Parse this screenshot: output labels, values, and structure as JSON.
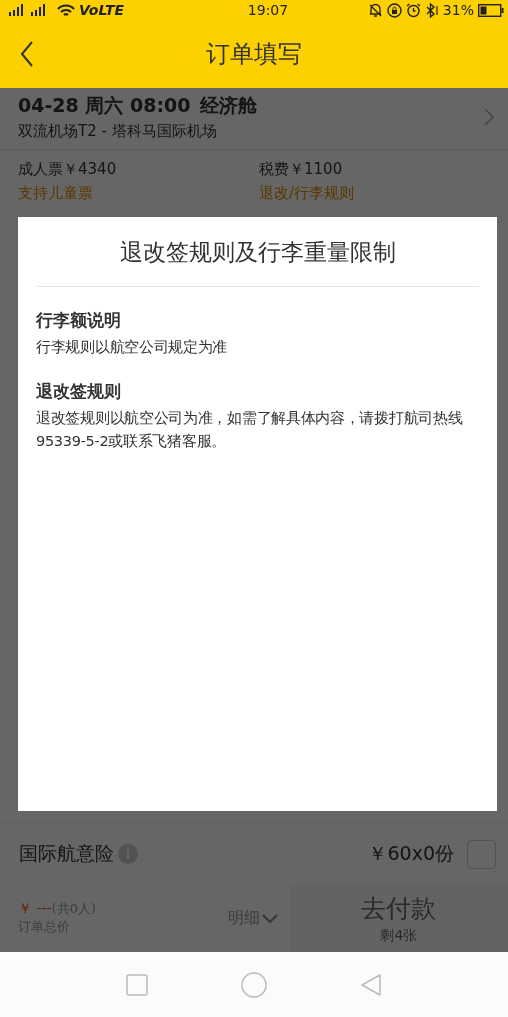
{
  "status_bar": {
    "network": "VoLTE",
    "time": "19:07",
    "battery": "31%"
  },
  "header": {
    "title": "订单填写"
  },
  "flight": {
    "datetime": "04-28 周六 08:00",
    "cabin": "经济舱",
    "route": "双流机场T2 - 塔科马国际机场"
  },
  "prices": [
    {
      "label": "成人票￥4340",
      "link": "支持儿童票"
    },
    {
      "label": "税费￥1100",
      "link": "退改/行李规则"
    }
  ],
  "dialog": {
    "title": "退改签规则及行李重量限制",
    "sections": [
      {
        "heading": "行李额说明",
        "body": "行李规则以航空公司规定为准"
      },
      {
        "heading": "退改签规则",
        "body": "退改签规则以航空公司为准，如需了解具体内容，请拨打航司热线95339-5-2或联系飞猪客服。"
      }
    ]
  },
  "insurance": {
    "label": "国际航意险",
    "price": "￥60x0份",
    "checked": false
  },
  "bottom_bar": {
    "currency": "￥",
    "amount": "---",
    "count": "(共0人)",
    "total_label": "订单总价",
    "details": "明细",
    "pay": "去付款",
    "remaining": "剩4张"
  }
}
